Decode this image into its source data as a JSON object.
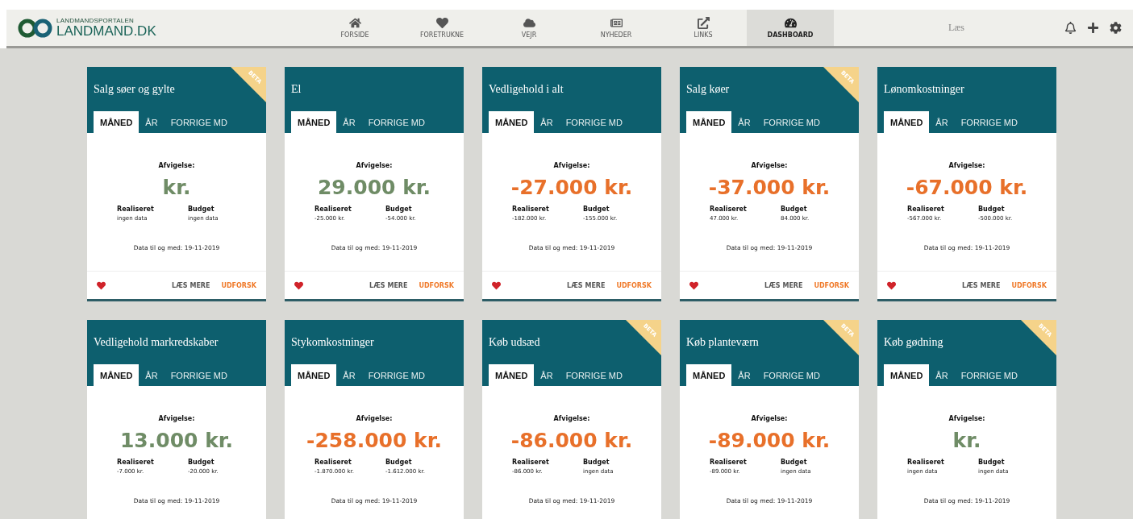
{
  "header": {
    "logo": {
      "tagline": "LANDMANDSPORTALEN",
      "name": "LANDMAND.DK"
    },
    "nav": [
      {
        "label": "FORSIDE",
        "selected": false
      },
      {
        "label": "FORETRUKNE",
        "selected": false
      },
      {
        "label": "VEJR",
        "selected": false
      },
      {
        "label": "NYHEDER",
        "selected": false
      },
      {
        "label": "LINKS",
        "selected": false
      },
      {
        "label": "DASHBOARD",
        "selected": true
      }
    ],
    "search": {
      "placeholder": "Læs"
    }
  },
  "cards": [
    {
      "title": "Salg søer og gylte",
      "beta": "BETA",
      "tabs": [
        {
          "label": "MÅNED",
          "selected": true
        },
        {
          "label": "ÅR",
          "selected": false
        },
        {
          "label": "FORRIGE MD",
          "selected": false
        }
      ],
      "deviation_label": "Afvigelse:",
      "deviation": "kr.",
      "color": "#6f8c66",
      "realized_label": "Realiseret",
      "realized": "ingen data",
      "budget_label": "Budget",
      "budget": "ingen data",
      "date": "Data til og med: 19-11-2019",
      "footer": {
        "favorite": true,
        "read_more": "LÆS MERE",
        "explore": "UDFORSK"
      }
    },
    {
      "title": "El",
      "tabs": [
        {
          "label": "MÅNED",
          "selected": true
        },
        {
          "label": "ÅR",
          "selected": false
        },
        {
          "label": "FORRIGE MD",
          "selected": false
        }
      ],
      "deviation_label": "Afvigelse:",
      "deviation": "29.000 kr.",
      "color": "#6f8c66",
      "realized_label": "Realiseret",
      "realized": "-25.000 kr.",
      "budget_label": "Budget",
      "budget": "-54.000 kr.",
      "date": "Data til og med: 19-11-2019",
      "footer": {
        "favorite": true,
        "read_more": "LÆS MERE",
        "explore": "UDFORSK"
      }
    },
    {
      "title": "Vedligehold i alt",
      "tabs": [
        {
          "label": "MÅNED",
          "selected": true
        },
        {
          "label": "ÅR",
          "selected": false
        },
        {
          "label": "FORRIGE MD",
          "selected": false
        }
      ],
      "deviation_label": "Afvigelse:",
      "deviation": "-27.000 kr.",
      "color": "#e8702a",
      "realized_label": "Realiseret",
      "realized": "-182.000 kr.",
      "budget_label": "Budget",
      "budget": "-155.000 kr.",
      "date": "Data til og med: 19-11-2019",
      "footer": {
        "favorite": true,
        "read_more": "LÆS MERE",
        "explore": "UDFORSK"
      }
    },
    {
      "title": "Salg køer",
      "beta": "BETA",
      "tabs": [
        {
          "label": "MÅNED",
          "selected": true
        },
        {
          "label": "ÅR",
          "selected": false
        },
        {
          "label": "FORRIGE MD",
          "selected": false
        }
      ],
      "deviation_label": "Afvigelse:",
      "deviation": "-37.000 kr.",
      "color": "#e8702a",
      "realized_label": "Realiseret",
      "realized": "47.000 kr.",
      "budget_label": "Budget",
      "budget": "84.000 kr.",
      "date": "Data til og med: 19-11-2019",
      "footer": {
        "favorite": true,
        "read_more": "LÆS MERE",
        "explore": "UDFORSK"
      }
    },
    {
      "title": "Lønomkostninger",
      "tabs": [
        {
          "label": "MÅNED",
          "selected": true
        },
        {
          "label": "ÅR",
          "selected": false
        },
        {
          "label": "FORRIGE MD",
          "selected": false
        }
      ],
      "deviation_label": "Afvigelse:",
      "deviation": "-67.000 kr.",
      "color": "#e8702a",
      "realized_label": "Realiseret",
      "realized": "-567.000 kr.",
      "budget_label": "Budget",
      "budget": "-500.000 kr.",
      "date": "Data til og med: 19-11-2019",
      "footer": {
        "favorite": true,
        "read_more": "LÆS MERE",
        "explore": "UDFORSK"
      }
    },
    {
      "title": "Vedligehold markredskaber",
      "tabs": [
        {
          "label": "MÅNED",
          "selected": true
        },
        {
          "label": "ÅR",
          "selected": false
        },
        {
          "label": "FORRIGE MD",
          "selected": false
        }
      ],
      "deviation_label": "Afvigelse:",
      "deviation": "13.000 kr.",
      "color": "#6f8c66",
      "realized_label": "Realiseret",
      "realized": "-7.000 kr.",
      "budget_label": "Budget",
      "budget": "-20.000 kr.",
      "date": "Data til og med: 19-11-2019"
    },
    {
      "title": "Stykomkostninger",
      "tabs": [
        {
          "label": "MÅNED",
          "selected": true
        },
        {
          "label": "ÅR",
          "selected": false
        },
        {
          "label": "FORRIGE MD",
          "selected": false
        }
      ],
      "deviation_label": "Afvigelse:",
      "deviation": "-258.000 kr.",
      "color": "#e8702a",
      "realized_label": "Realiseret",
      "realized": "-1.870.000 kr.",
      "budget_label": "Budget",
      "budget": "-1.612.000 kr.",
      "date": "Data til og med: 19-11-2019"
    },
    {
      "title": "Køb udsæd",
      "beta": "BETA",
      "tabs": [
        {
          "label": "MÅNED",
          "selected": true
        },
        {
          "label": "ÅR",
          "selected": false
        },
        {
          "label": "FORRIGE MD",
          "selected": false
        }
      ],
      "deviation_label": "Afvigelse:",
      "deviation": "-86.000 kr.",
      "color": "#e8702a",
      "realized_label": "Realiseret",
      "realized": "-86.000 kr.",
      "budget_label": "Budget",
      "budget": "ingen data",
      "date": "Data til og med: 19-11-2019"
    },
    {
      "title": "Køb planteværn",
      "beta": "BETA",
      "tabs": [
        {
          "label": "MÅNED",
          "selected": true
        },
        {
          "label": "ÅR",
          "selected": false
        },
        {
          "label": "FORRIGE MD",
          "selected": false
        }
      ],
      "deviation_label": "Afvigelse:",
      "deviation": "-89.000 kr.",
      "color": "#e8702a",
      "realized_label": "Realiseret",
      "realized": "-89.000 kr.",
      "budget_label": "Budget",
      "budget": "ingen data",
      "date": "Data til og med: 19-11-2019"
    },
    {
      "title": "Køb gødning",
      "beta": "BETA",
      "tabs": [
        {
          "label": "MÅNED",
          "selected": true
        },
        {
          "label": "ÅR",
          "selected": false
        },
        {
          "label": "FORRIGE MD",
          "selected": false
        }
      ],
      "deviation_label": "Afvigelse:",
      "deviation": "kr.",
      "color": "#6f8c66",
      "realized_label": "Realiseret",
      "realized": "ingen data",
      "budget_label": "Budget",
      "budget": "ingen data",
      "date": "Data til og med: 19-11-2019"
    }
  ]
}
